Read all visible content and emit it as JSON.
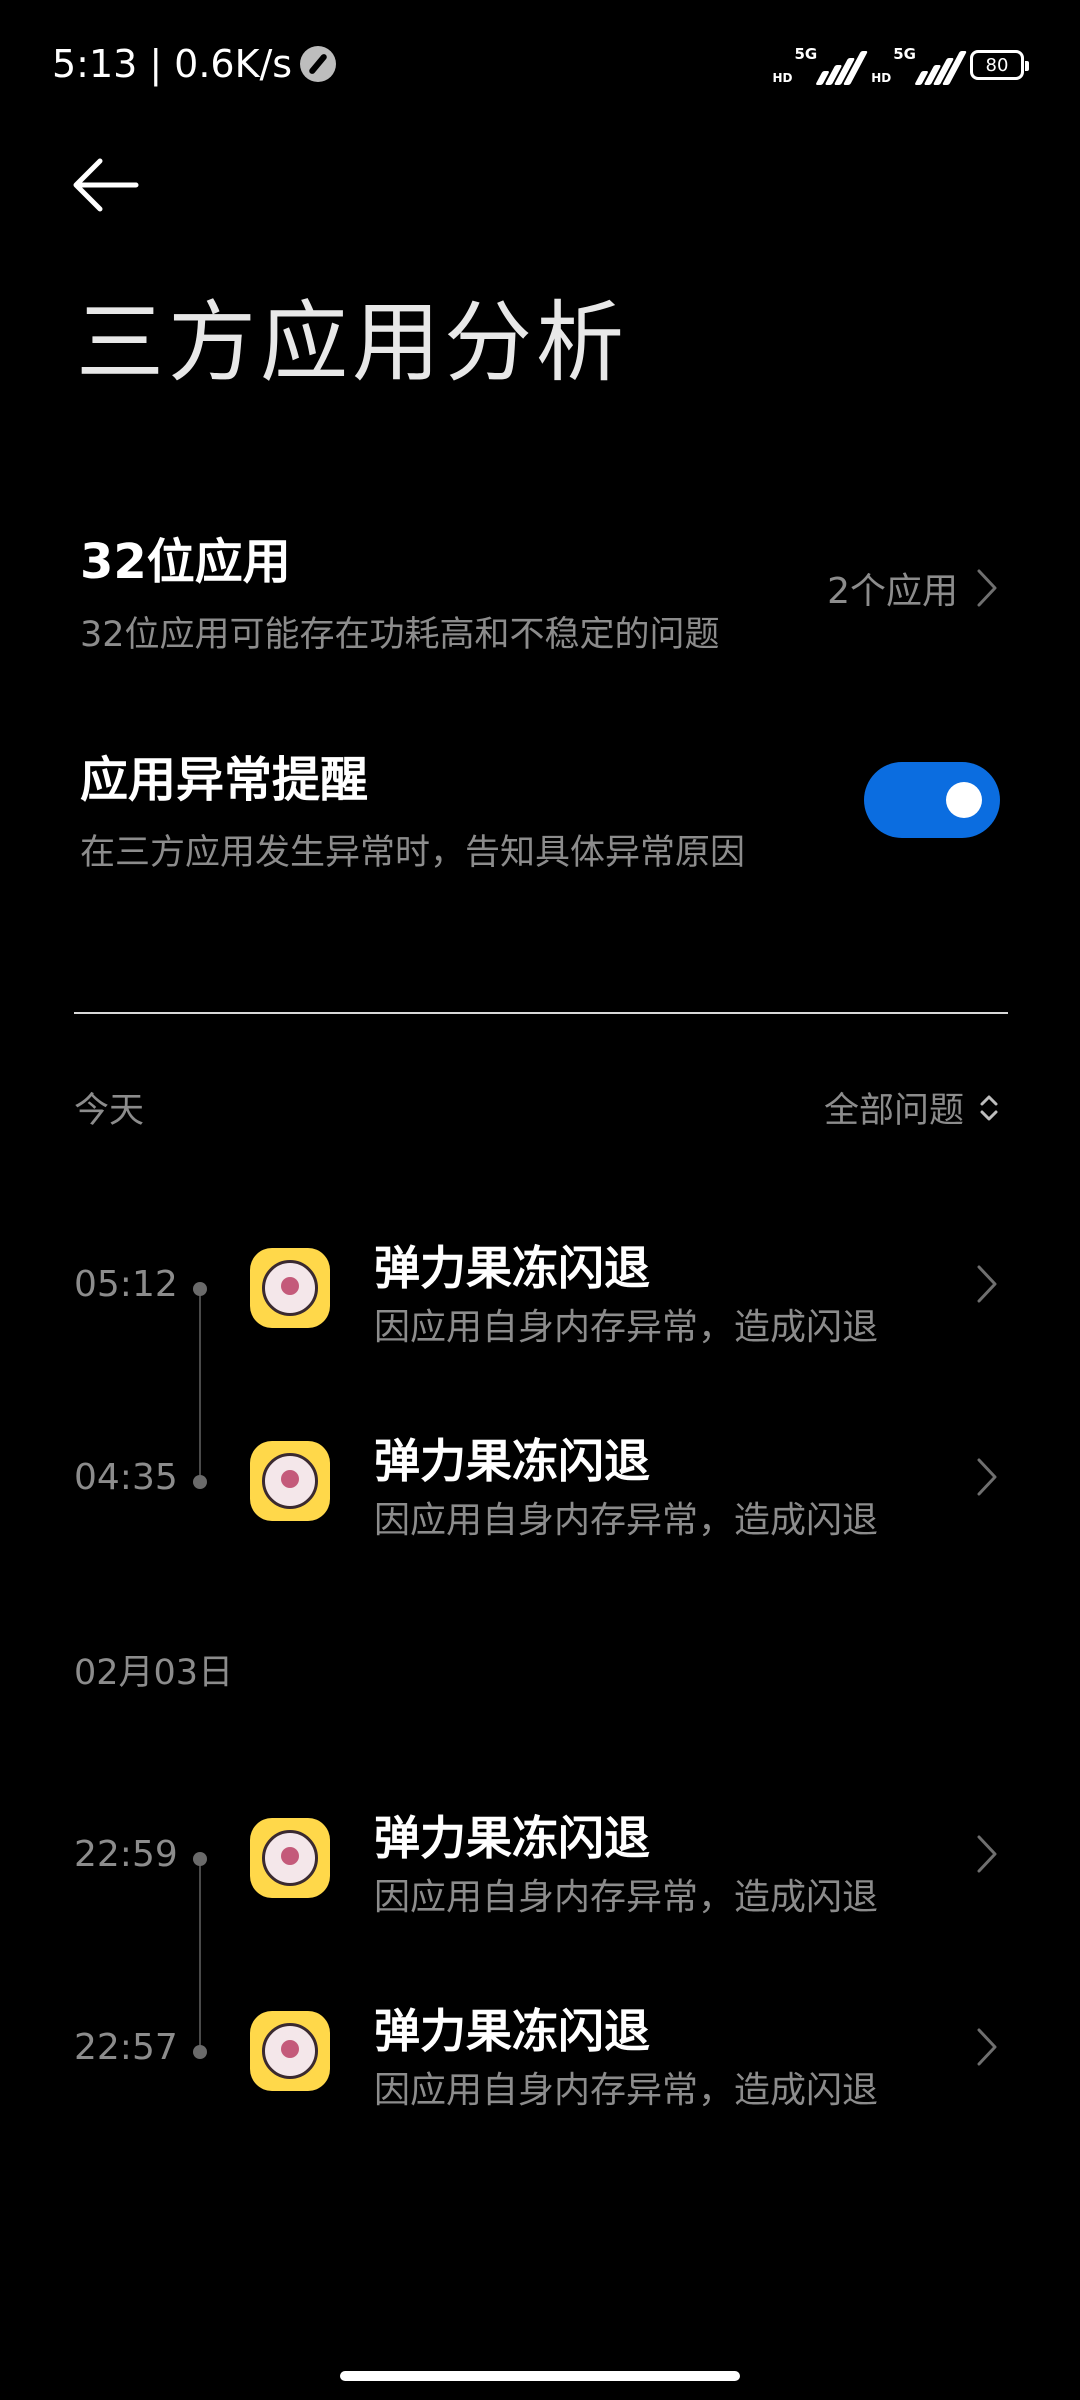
{
  "status_bar": {
    "time": "5:13",
    "separator": "|",
    "speed": "0.6K/s",
    "signal1_hd": "HD",
    "signal1_gen": "5G",
    "signal2_hd": "HD",
    "signal2_gen": "5G",
    "battery": "80"
  },
  "header": {
    "back_icon": "arrow-left-icon",
    "title": "三方应用分析"
  },
  "settings": {
    "apps32": {
      "title": "32位应用",
      "description": "32位应用可能存在功耗高和不稳定的问题",
      "value": "2个应用"
    },
    "alert": {
      "title": "应用异常提醒",
      "description": "在三方应用发生异常时，告知具体异常原因",
      "enabled": true
    }
  },
  "filter": {
    "label": "全部问题",
    "icon": "sort-updown-icon"
  },
  "sections": [
    {
      "label": "今天",
      "items": [
        {
          "time": "05:12",
          "name": "弹力果冻闪退",
          "reason": "因应用自身内存异常，造成闪退"
        },
        {
          "time": "04:35",
          "name": "弹力果冻闪退",
          "reason": "因应用自身内存异常，造成闪退"
        }
      ]
    },
    {
      "label": "02月03日",
      "items": [
        {
          "time": "22:59",
          "name": "弹力果冻闪退",
          "reason": "因应用自身内存异常，造成闪退"
        },
        {
          "time": "22:57",
          "name": "弹力果冻闪退",
          "reason": "因应用自身内存异常，造成闪退"
        }
      ]
    }
  ],
  "colors": {
    "background": "#000000",
    "accent": "#0b6de0",
    "secondary_text": "#8c8c8c",
    "app_icon": "#ffd84a"
  }
}
